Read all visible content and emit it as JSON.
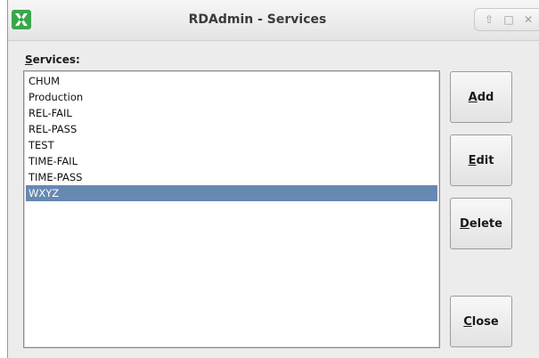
{
  "window": {
    "title": "RDAdmin - Services",
    "controls": [
      "maximize-icon",
      "restore-icon",
      "close-icon"
    ]
  },
  "services": {
    "label_mnemonic": "S",
    "label_rest": "ervices:",
    "items": [
      {
        "label": "CHUM",
        "selected": false
      },
      {
        "label": "Production",
        "selected": false
      },
      {
        "label": "REL-FAIL",
        "selected": false
      },
      {
        "label": "REL-PASS",
        "selected": false
      },
      {
        "label": "TEST",
        "selected": false
      },
      {
        "label": "TIME-FAIL",
        "selected": false
      },
      {
        "label": "TIME-PASS",
        "selected": false
      },
      {
        "label": "WXYZ",
        "selected": true
      }
    ]
  },
  "buttons": {
    "add": {
      "mnemonic": "A",
      "rest": "dd"
    },
    "edit": {
      "mnemonic": "E",
      "rest": "dit"
    },
    "delete": {
      "mnemonic": "D",
      "rest": "elete"
    },
    "close": {
      "mnemonic": "C",
      "rest": "lose"
    }
  },
  "colors": {
    "selection": "#6788b1",
    "app_icon": "#3aa64a"
  }
}
